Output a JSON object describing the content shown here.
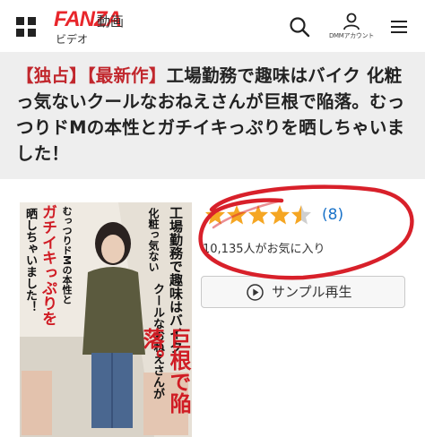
{
  "header": {
    "logo": "FANZA",
    "section": "動画",
    "category": "ビデオ",
    "account_label": "DMMアカウント"
  },
  "product": {
    "title_tag_1": "【独占】",
    "title_tag_2": "【最新作】",
    "title_body": "工場勤務で趣味はバイク 化粧っ気ないクールなおねえさんが巨根で陥落。むっつりドMの本性とガチイキっぷりを晒しちゃいました！",
    "rating_value": 4.5,
    "rating_max": 5,
    "review_count": "(8)",
    "favorites": "10,135人がお気に入り",
    "sample_button": "サンプル再生"
  },
  "cover": {
    "headline_1": "工場勤務で趣味はバイク",
    "headline_2": "化粧っ気ない",
    "headline_3": "クールなおねえさんが",
    "headline_4": "巨根で陥落。",
    "headline_5": "むっつりドMの本性と",
    "headline_6": "ガチイキっぷりを",
    "headline_7": "晒しちゃいました！"
  },
  "colors": {
    "brand_red": "#e8262b",
    "tag_red": "#c1272d",
    "star": "#f5a623",
    "link_blue": "#1a73c9",
    "annotation_red": "#d8202a"
  },
  "icons": [
    "grid-icon",
    "search-icon",
    "account-icon",
    "menu-icon",
    "star-icon",
    "play-icon"
  ]
}
